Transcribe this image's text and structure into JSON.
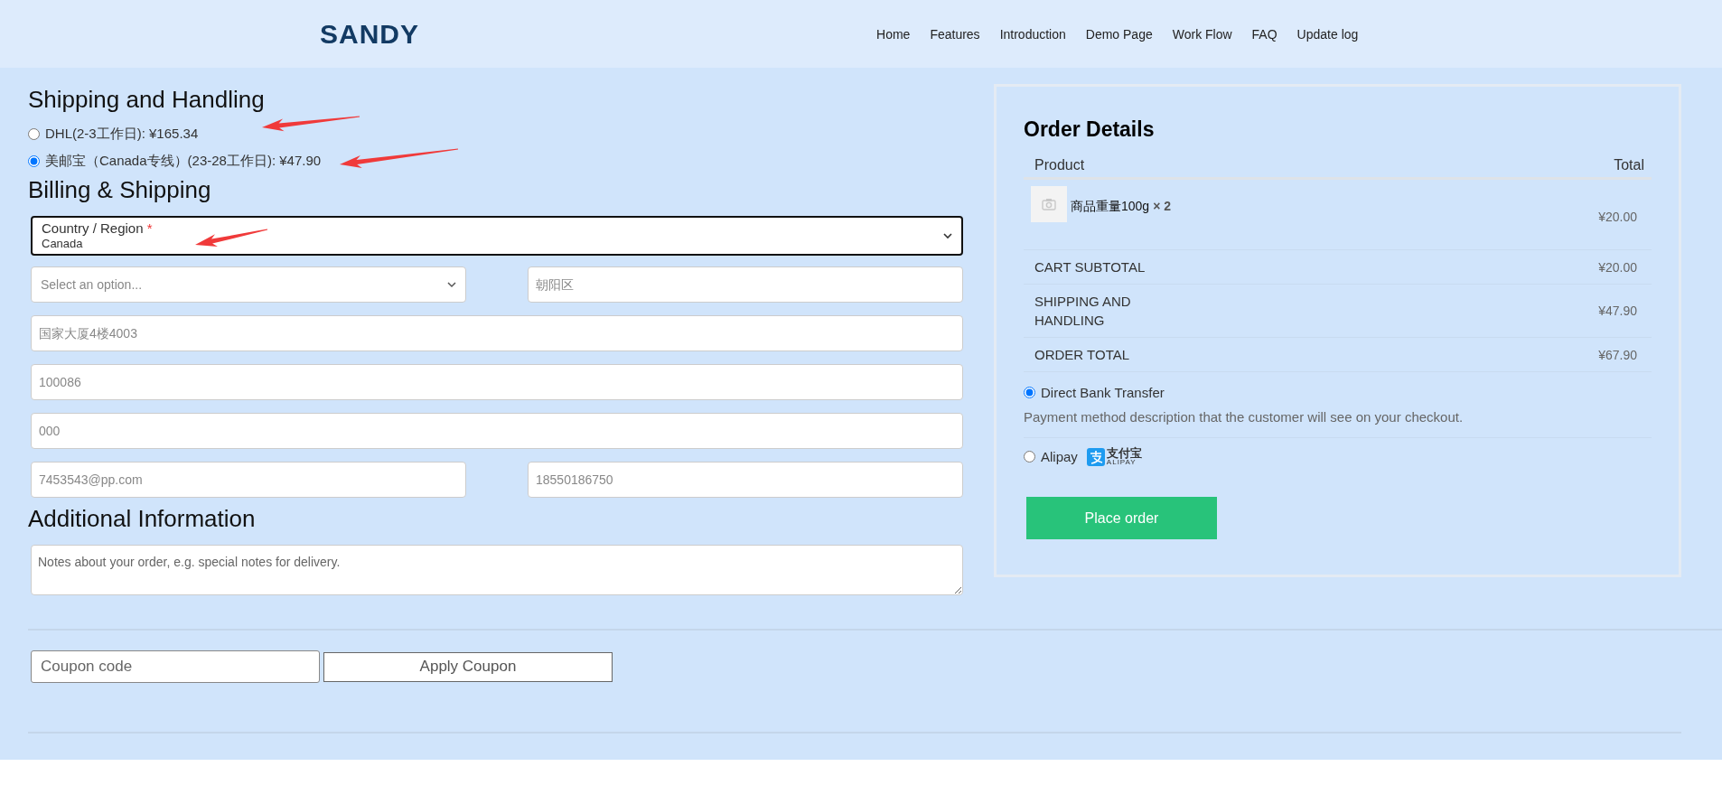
{
  "header": {
    "logo": "SANDY",
    "nav": [
      {
        "label": "Home"
      },
      {
        "label": "Features"
      },
      {
        "label": "Introduction"
      },
      {
        "label": "Demo Page"
      },
      {
        "label": "Work Flow"
      },
      {
        "label": "FAQ"
      },
      {
        "label": "Update log"
      }
    ]
  },
  "shipping": {
    "title": "Shipping and Handling",
    "options": [
      {
        "label": "DHL(2-3工作日): ¥165.34",
        "selected": false
      },
      {
        "label": "美邮宝（Canada专线）(23-28工作日): ¥47.90",
        "selected": true
      }
    ]
  },
  "billing": {
    "title": "Billing & Shipping",
    "country": {
      "label": "Country / Region",
      "required_mark": "*",
      "value": "Canada"
    },
    "rows": [
      [
        {
          "kind": "select",
          "placeholder": "Select an option..."
        },
        {
          "kind": "input",
          "placeholder": "朝阳区"
        }
      ],
      [
        {
          "kind": "input",
          "placeholder": "国家大厦4楼4003"
        }
      ],
      [
        {
          "kind": "input",
          "placeholder": "100086"
        }
      ],
      [
        {
          "kind": "input",
          "placeholder": "000"
        }
      ],
      [
        {
          "kind": "input",
          "placeholder": "7453543@pp.com"
        },
        {
          "kind": "input",
          "placeholder": "18550186750"
        }
      ]
    ]
  },
  "additional": {
    "title": "Additional Information",
    "notes": {
      "placeholder": "Notes about your order, e.g. special notes for delivery."
    }
  },
  "coupon": {
    "placeholder": "Coupon code",
    "button": "Apply Coupon"
  },
  "order": {
    "title": "Order Details",
    "columns": [
      "Product",
      "Total"
    ],
    "items": [
      {
        "name": "商品重量100g",
        "qty": "× 2",
        "total": "¥20.00"
      }
    ],
    "totals": [
      {
        "label": "CART SUBTOTAL",
        "value": "¥20.00"
      },
      {
        "label": "SHIPPING AND HANDLING",
        "value": "¥47.90"
      },
      {
        "label": "ORDER TOTAL",
        "value": "¥67.90"
      }
    ],
    "payment": [
      {
        "label": "Direct Bank Transfer",
        "selected": true,
        "description": "Payment method description that the customer will see on your checkout."
      },
      {
        "label": "Alipay",
        "selected": false,
        "logo": {
          "cn": "支付宝",
          "en": "ALIPAY"
        }
      }
    ],
    "place_order": "Place order"
  }
}
